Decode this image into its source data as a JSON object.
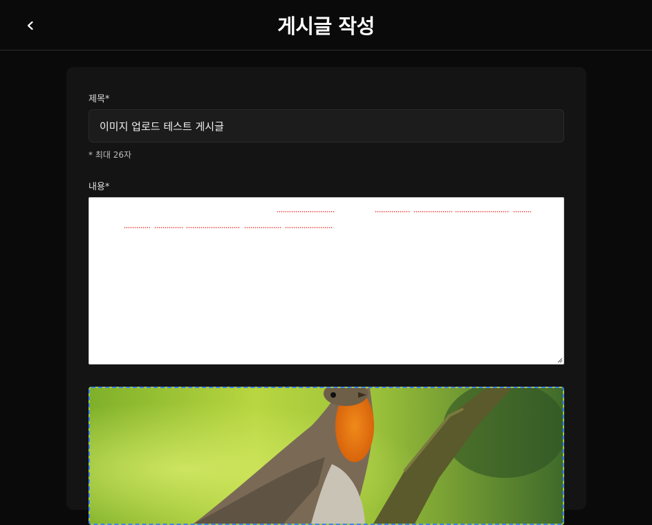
{
  "header": {
    "title": "게시글 작성",
    "back_icon": "chevron-left-icon"
  },
  "form": {
    "title_label": "제목*",
    "title_value": "이미지 업로드 테스트 게시글",
    "title_hint": "* 최대 26자",
    "content_label": "내용*",
    "content_value": ""
  },
  "upload": {
    "image_subject": "robin-on-branch",
    "border_color": "#3b82f6"
  },
  "colors": {
    "background": "#0a0a0a",
    "card": "#141414",
    "accent": "#3b82f6",
    "spellcheck": "#e53935"
  }
}
